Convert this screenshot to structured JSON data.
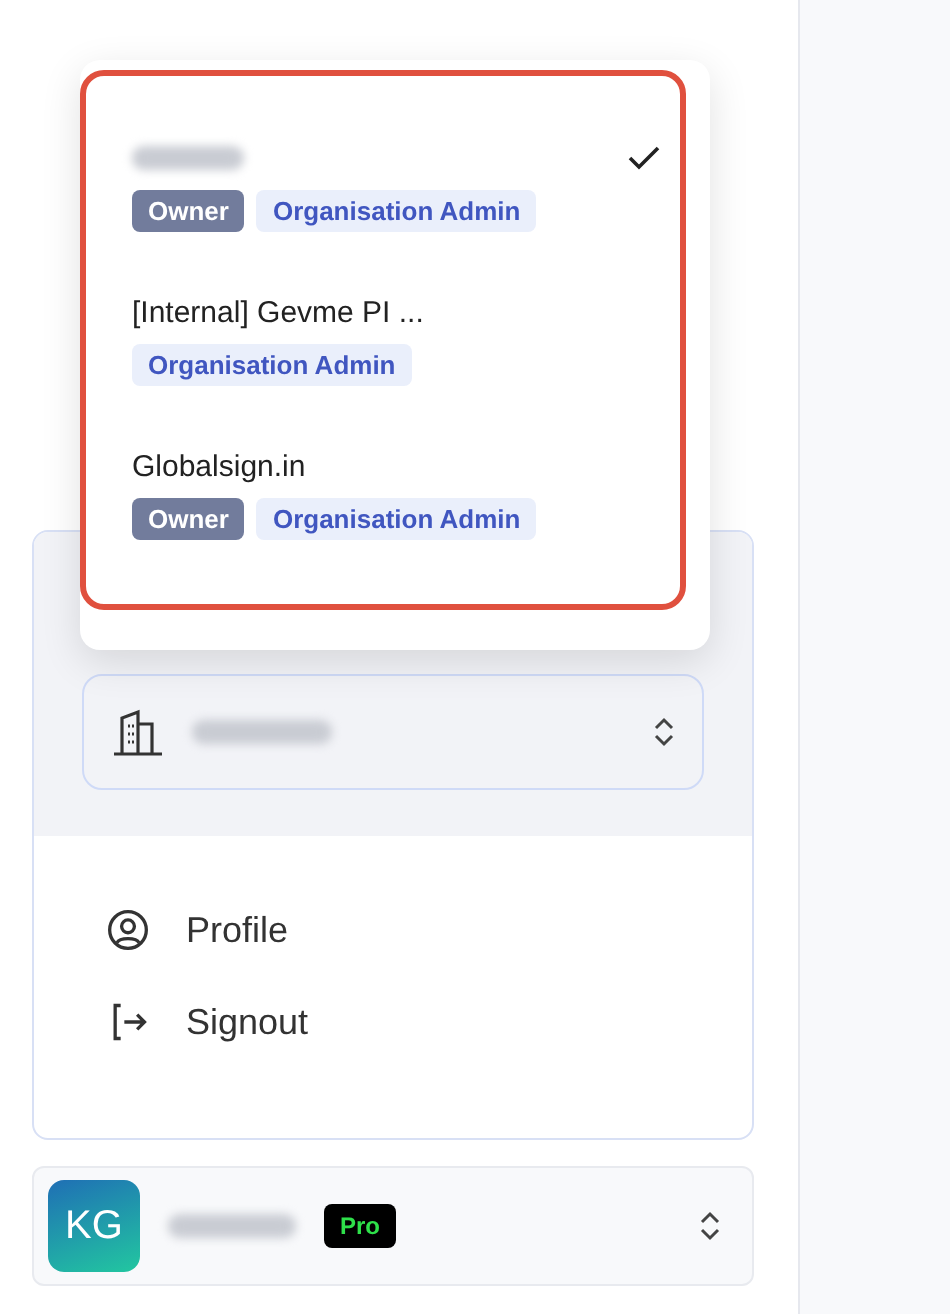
{
  "org_menu": {
    "highlighted": true,
    "items": [
      {
        "redacted": true,
        "selected": true,
        "roles": [
          {
            "kind": "owner",
            "label": "Owner"
          },
          {
            "kind": "admin",
            "label": "Organisation Admin"
          }
        ]
      },
      {
        "redacted": false,
        "name": "[Internal] Gevme PI ...",
        "selected": false,
        "roles": [
          {
            "kind": "admin",
            "label": "Organisation Admin"
          }
        ]
      },
      {
        "redacted": false,
        "name": "Globalsign.in",
        "selected": false,
        "roles": [
          {
            "kind": "owner",
            "label": "Owner"
          },
          {
            "kind": "admin",
            "label": "Organisation Admin"
          }
        ]
      }
    ]
  },
  "org_select": {
    "redacted": true
  },
  "account_menu": [
    {
      "kind": "profile",
      "label": "Profile"
    },
    {
      "kind": "signout",
      "label": "Signout"
    }
  ],
  "user_bar": {
    "initials": "KG",
    "redacted": true,
    "plan": "Pro"
  }
}
